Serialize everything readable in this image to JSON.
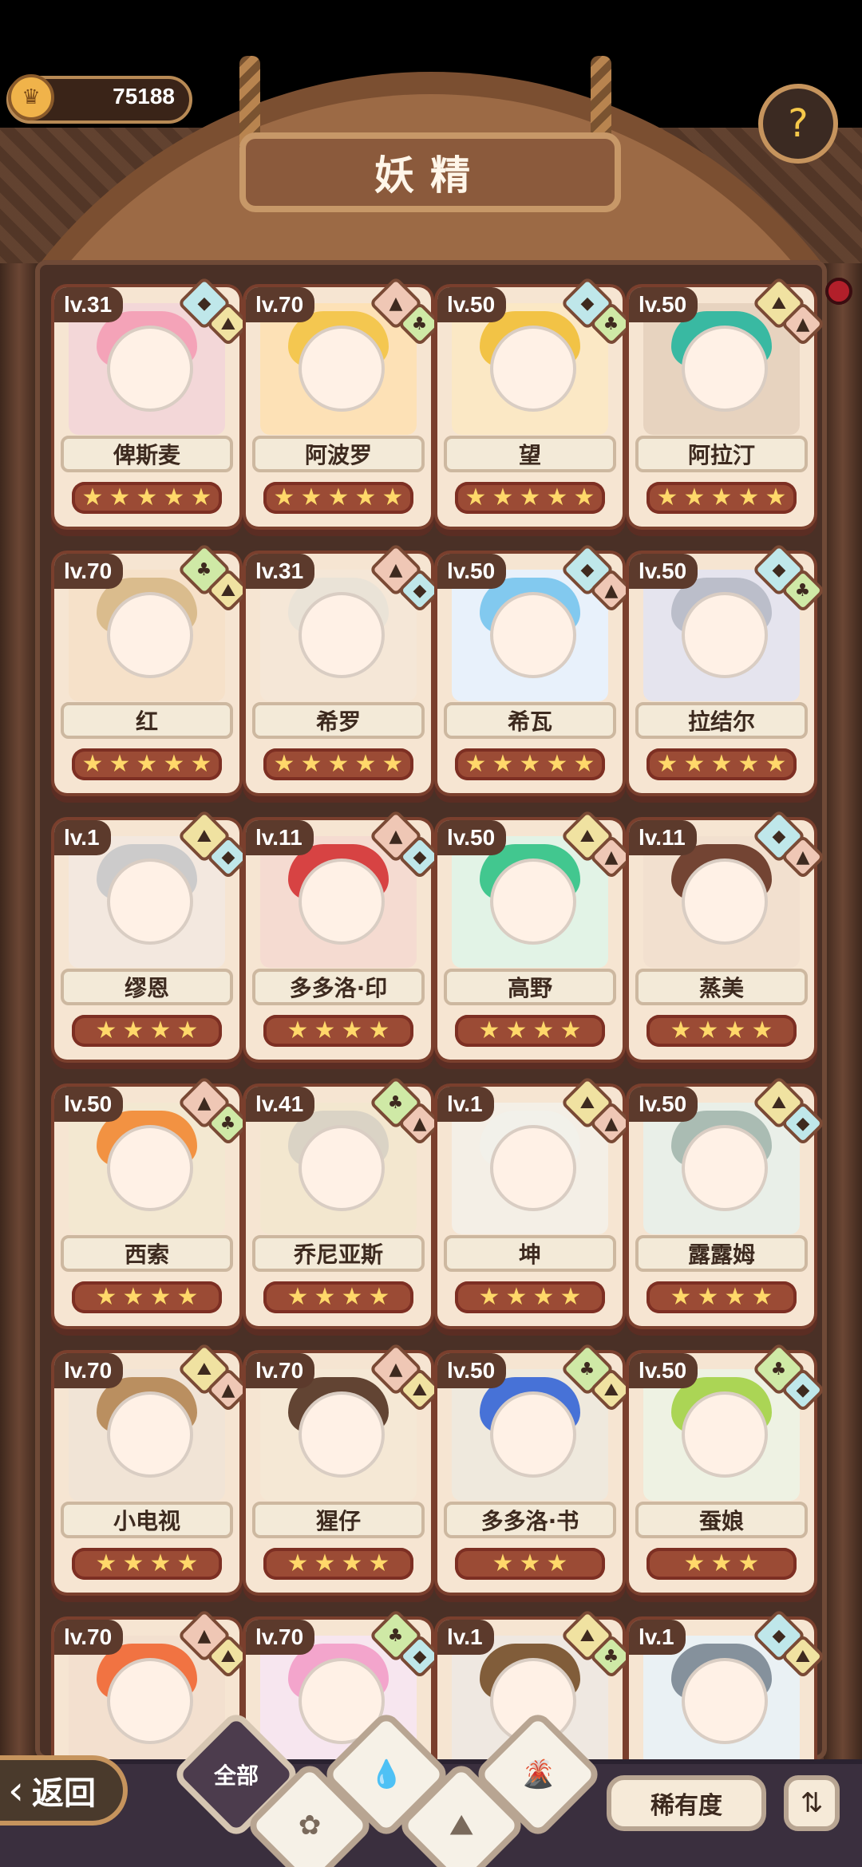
{
  "header": {
    "title": "妖精",
    "currency": {
      "value": "75188",
      "icon": "crown-coin-icon"
    },
    "help_icon": "seedling-question-icon"
  },
  "cards": [
    {
      "level": "lv.31",
      "name": "俾斯麦",
      "stars": 5,
      "badges": [
        "water-element-icon",
        "mountain-element-icon"
      ],
      "palette": {
        "bg": "#f3d7d8",
        "hair": "#f3a0b6"
      }
    },
    {
      "level": "lv.70",
      "name": "阿波罗",
      "stars": 5,
      "badges": [
        "volcano-element-icon",
        "leaf-element-icon"
      ],
      "palette": {
        "bg": "#fde1b6",
        "hair": "#f3c54b"
      }
    },
    {
      "level": "lv.50",
      "name": "望",
      "stars": 5,
      "badges": [
        "water-element-icon",
        "leaf-element-icon"
      ],
      "palette": {
        "bg": "#fbe8c5",
        "hair": "#f1c13f"
      }
    },
    {
      "level": "lv.50",
      "name": "阿拉汀",
      "stars": 5,
      "badges": [
        "mountain-element-icon",
        "volcano-element-icon"
      ],
      "palette": {
        "bg": "#e7d3bf",
        "hair": "#2fb7a0"
      }
    },
    {
      "level": "lv.70",
      "name": "红",
      "stars": 5,
      "badges": [
        "leaf-element-icon",
        "mountain-element-icon"
      ],
      "palette": {
        "bg": "#f6e1c9",
        "hair": "#d8b98a"
      }
    },
    {
      "level": "lv.31",
      "name": "希罗",
      "stars": 5,
      "badges": [
        "volcano-element-icon",
        "water-element-icon"
      ],
      "palette": {
        "bg": "#f5e7d7",
        "hair": "#e9e3d7"
      }
    },
    {
      "level": "lv.50",
      "name": "希瓦",
      "stars": 5,
      "badges": [
        "water-element-icon",
        "volcano-element-icon"
      ],
      "palette": {
        "bg": "#e8f1fb",
        "hair": "#7cc6ee"
      }
    },
    {
      "level": "lv.50",
      "name": "拉结尔",
      "stars": 5,
      "badges": [
        "water-element-icon",
        "leaf-element-icon"
      ],
      "palette": {
        "bg": "#e5e4ee",
        "hair": "#b8bcc7"
      }
    },
    {
      "level": "lv.1",
      "name": "缪恩",
      "stars": 4,
      "badges": [
        "mountain-element-icon",
        "water-element-icon"
      ],
      "palette": {
        "bg": "#f3e8df",
        "hair": "#c9c9c9"
      }
    },
    {
      "level": "lv.11",
      "name": "多多洛·印",
      "stars": 4,
      "badges": [
        "volcano-element-icon",
        "water-element-icon"
      ],
      "palette": {
        "bg": "#f5dbd1",
        "hair": "#d53b3b"
      }
    },
    {
      "level": "lv.50",
      "name": "高野",
      "stars": 4,
      "badges": [
        "mountain-element-icon",
        "volcano-element-icon"
      ],
      "palette": {
        "bg": "#e2f3e6",
        "hair": "#39c48a"
      }
    },
    {
      "level": "lv.11",
      "name": "蒸美",
      "stars": 4,
      "badges": [
        "water-element-icon",
        "volcano-element-icon"
      ],
      "palette": {
        "bg": "#f2e0cf",
        "hair": "#6b3b2a"
      }
    },
    {
      "level": "lv.50",
      "name": "西索",
      "stars": 4,
      "badges": [
        "volcano-element-icon",
        "leaf-element-icon"
      ],
      "palette": {
        "bg": "#f3e8d1",
        "hair": "#f18d3a"
      }
    },
    {
      "level": "lv.41",
      "name": "乔尼亚斯",
      "stars": 4,
      "badges": [
        "leaf-element-icon",
        "volcano-element-icon"
      ],
      "palette": {
        "bg": "#f3e7cf",
        "hair": "#d8d2c4"
      }
    },
    {
      "level": "lv.1",
      "name": "坤",
      "stars": 4,
      "badges": [
        "mountain-element-icon",
        "volcano-element-icon"
      ],
      "palette": {
        "bg": "#f4efe6",
        "hair": "#f1f0ea"
      }
    },
    {
      "level": "lv.50",
      "name": "露露姆",
      "stars": 4,
      "badges": [
        "mountain-element-icon",
        "water-element-icon"
      ],
      "palette": {
        "bg": "#e9efe8",
        "hair": "#a6b8b0"
      }
    },
    {
      "level": "lv.70",
      "name": "小电视",
      "stars": 4,
      "badges": [
        "mountain-element-icon",
        "volcano-element-icon"
      ],
      "palette": {
        "bg": "#f1e4d6",
        "hair": "#b68a5a"
      }
    },
    {
      "level": "lv.70",
      "name": "猩仔",
      "stars": 4,
      "badges": [
        "volcano-element-icon",
        "mountain-element-icon"
      ],
      "palette": {
        "bg": "#f5e8d5",
        "hair": "#5a3b2a"
      }
    },
    {
      "level": "lv.50",
      "name": "多多洛·书",
      "stars": 3,
      "badges": [
        "leaf-element-icon",
        "mountain-element-icon"
      ],
      "palette": {
        "bg": "#efe9dd",
        "hair": "#3d6cd6"
      }
    },
    {
      "level": "lv.50",
      "name": "蚕娘",
      "stars": 3,
      "badges": [
        "leaf-element-icon",
        "water-element-icon"
      ],
      "palette": {
        "bg": "#eef2e3",
        "hair": "#a6d34d"
      }
    },
    {
      "level": "lv.70",
      "name": "",
      "stars": 0,
      "badges": [
        "volcano-element-icon",
        "mountain-element-icon"
      ],
      "palette": {
        "bg": "#f3e0cf",
        "hair": "#f06d3a"
      }
    },
    {
      "level": "lv.70",
      "name": "",
      "stars": 0,
      "badges": [
        "leaf-element-icon",
        "water-element-icon"
      ],
      "palette": {
        "bg": "#f7e6ef",
        "hair": "#f2a1c9"
      }
    },
    {
      "level": "lv.1",
      "name": "",
      "stars": 0,
      "badges": [
        "mountain-element-icon",
        "leaf-element-icon"
      ],
      "palette": {
        "bg": "#efe8e1",
        "hair": "#7a5530"
      }
    },
    {
      "level": "lv.1",
      "name": "",
      "stars": 0,
      "badges": [
        "water-element-icon",
        "mountain-element-icon"
      ],
      "palette": {
        "bg": "#eaf1f4",
        "hair": "#7f8b97"
      }
    }
  ],
  "footer": {
    "back_label": "返回",
    "filters": [
      {
        "label": "全部",
        "icon": "all-icon",
        "active": true
      },
      {
        "label": "",
        "icon": "water-drop-icon",
        "active": false
      },
      {
        "label": "",
        "icon": "leaf-icon",
        "active": false
      },
      {
        "label": "",
        "icon": "mountain-icon",
        "active": false
      },
      {
        "label": "",
        "icon": "volcano-icon",
        "active": false
      }
    ],
    "rarity_label": "稀有度",
    "sort_icon": "sort-icon"
  }
}
